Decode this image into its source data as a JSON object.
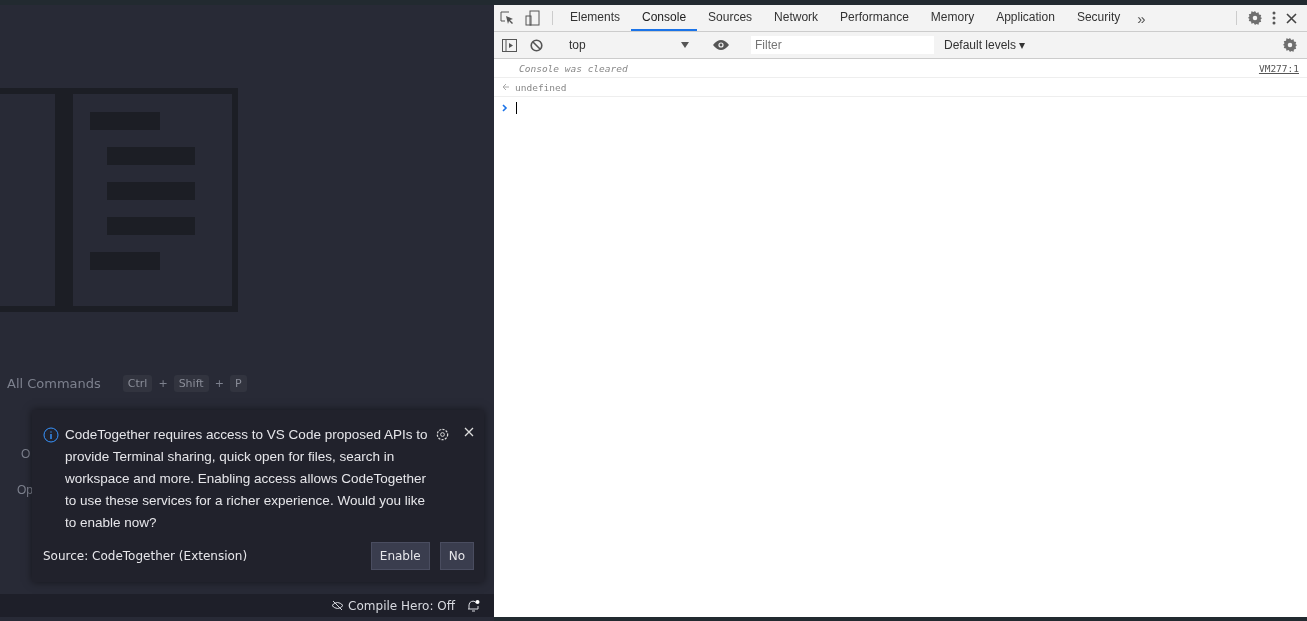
{
  "editor": {
    "shortcut": {
      "label": "All Commands",
      "keys": [
        "Ctrl",
        "Shift",
        "P"
      ],
      "joiner": "+"
    },
    "hidden_rows": [
      "O",
      "Op"
    ]
  },
  "notification": {
    "message": "CodeTogether requires access to VS Code proposed APIs to provide Terminal sharing, quick open for files, search in workspace and more. Enabling access allows CodeTogether to use these services for a richer experience. Would you like to enable now?",
    "source": "Source: CodeTogether (Extension)",
    "buttons": [
      "Enable",
      "No"
    ]
  },
  "status_bar": {
    "item": "Compile Hero: Off"
  },
  "devtools": {
    "tabs": [
      {
        "label": "Elements",
        "selected": false
      },
      {
        "label": "Console",
        "selected": true
      },
      {
        "label": "Sources",
        "selected": false
      },
      {
        "label": "Network",
        "selected": false
      },
      {
        "label": "Performance",
        "selected": false
      },
      {
        "label": "Memory",
        "selected": false
      },
      {
        "label": "Application",
        "selected": false
      },
      {
        "label": "Security",
        "selected": false
      }
    ],
    "more": "»",
    "context": "top",
    "filter_placeholder": "Filter",
    "levels": "Default levels ▾",
    "messages": [
      {
        "kind": "info",
        "text": "Console was cleared",
        "link": "VM277:1"
      },
      {
        "kind": "result",
        "text": "undefined"
      },
      {
        "kind": "prompt"
      }
    ]
  }
}
